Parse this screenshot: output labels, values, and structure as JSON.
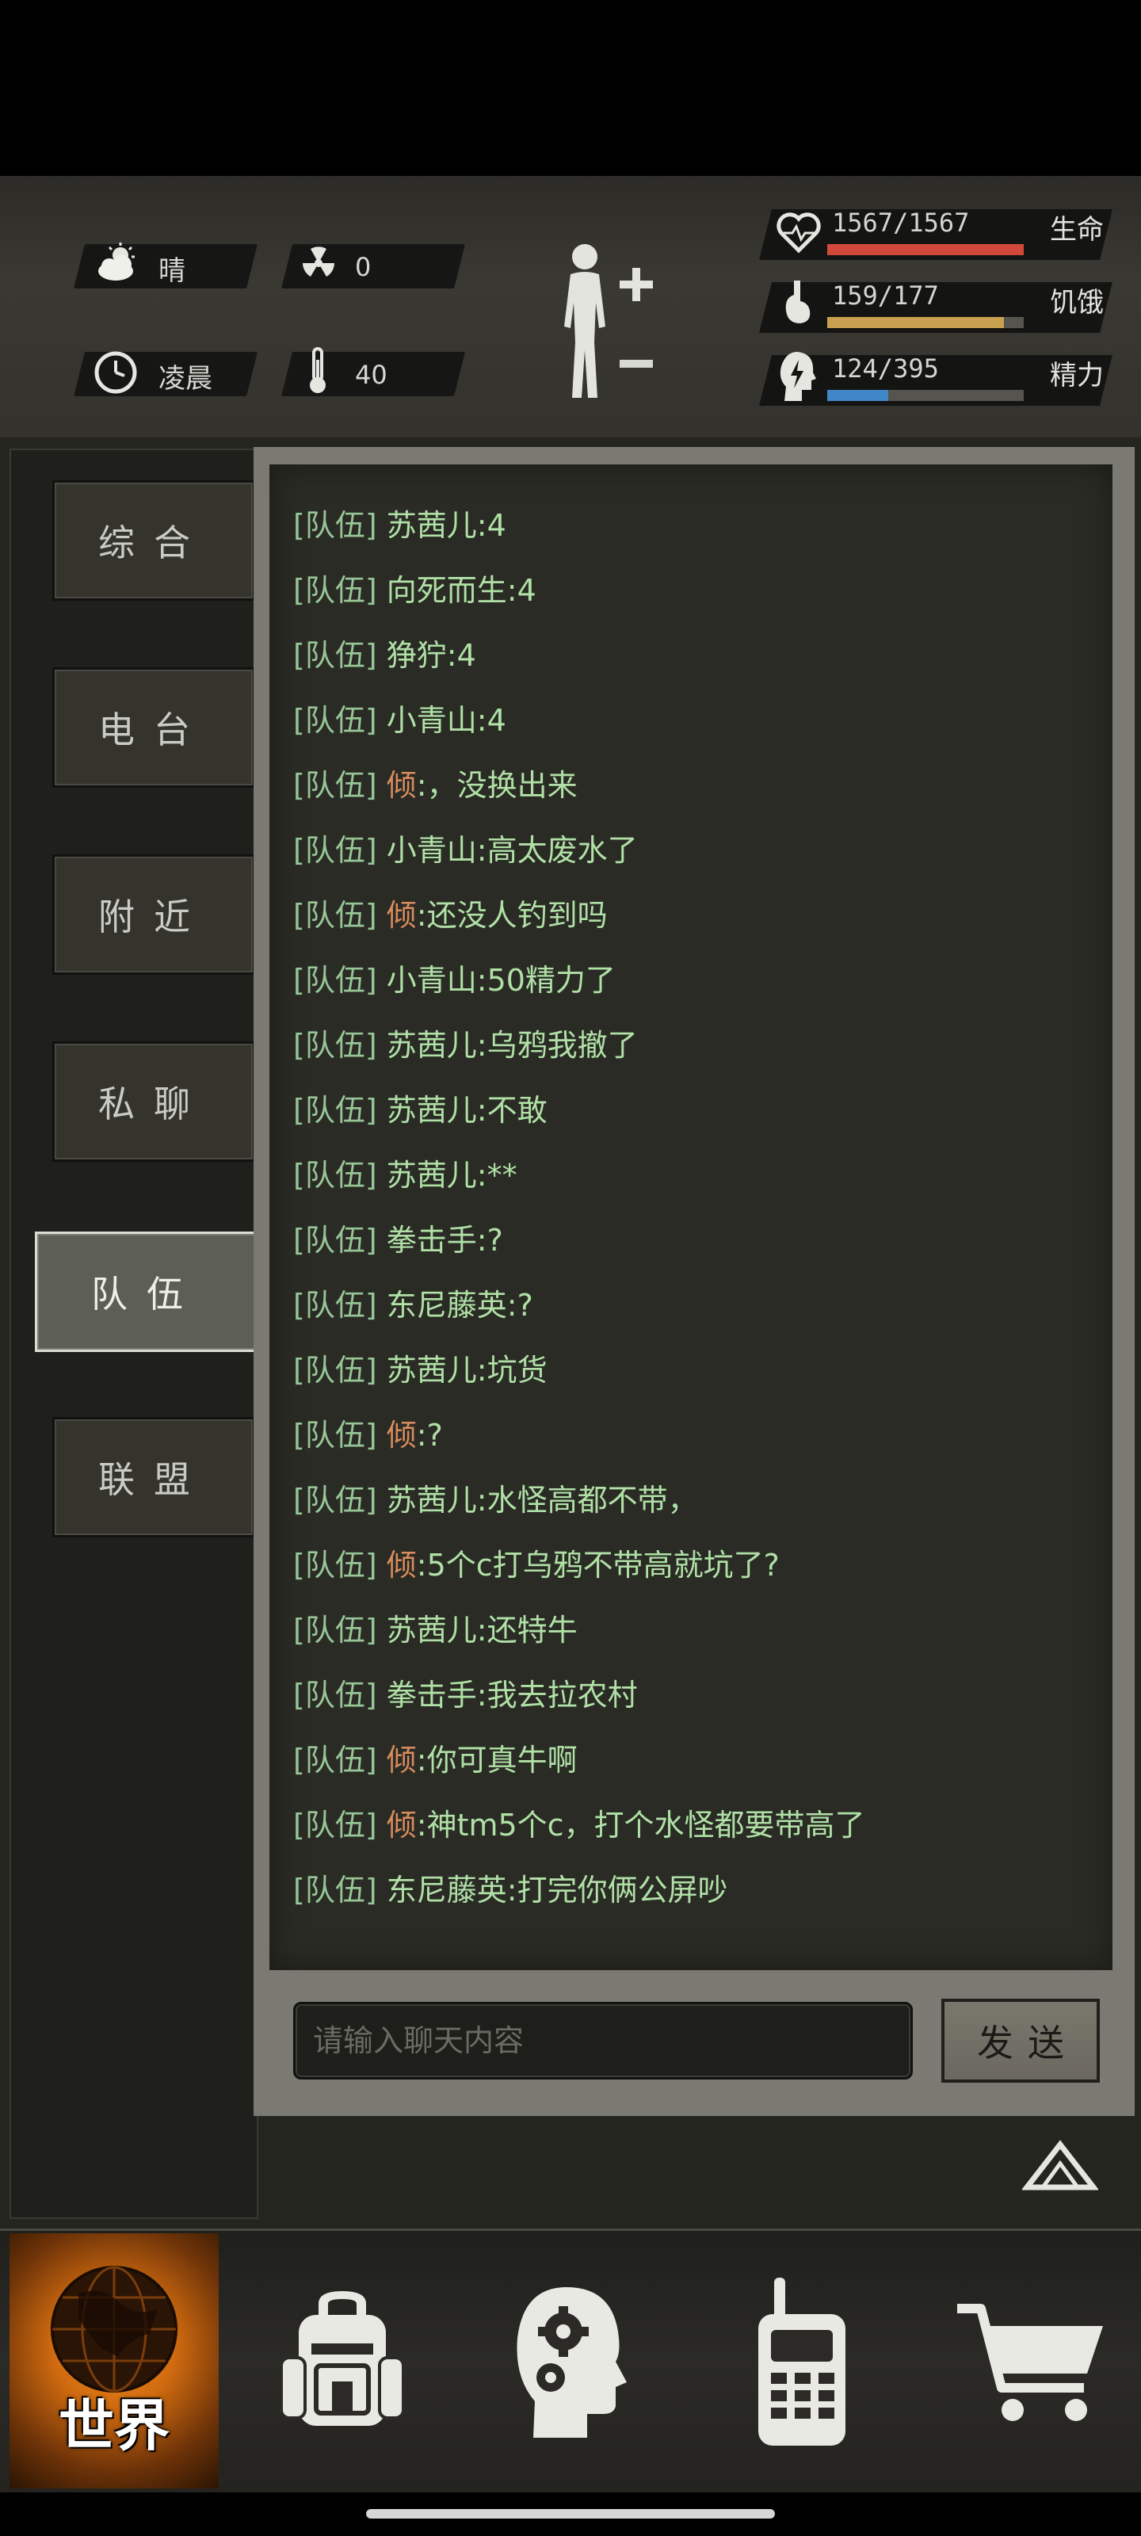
{
  "weather": {
    "label": "晴",
    "icon": "partly-cloudy-icon"
  },
  "radiation": {
    "value": "0",
    "icon": "radiation-icon"
  },
  "time_of_day": {
    "label": "凌晨",
    "icon": "clock-icon"
  },
  "temperature": {
    "value": "40",
    "icon": "thermometer-icon"
  },
  "stats": {
    "life": {
      "label": "生命",
      "value": "1567/1567",
      "fraction": 1.0,
      "color": "#d2493c",
      "icon": "heart-pulse-icon"
    },
    "hunger": {
      "label": "饥饿",
      "value": "159/177",
      "fraction": 0.9,
      "color": "#c8a050",
      "icon": "stomach-icon"
    },
    "energy": {
      "label": "精力",
      "value": "124/395",
      "fraction": 0.31,
      "color": "#3f86c8",
      "icon": "energy-head-icon"
    }
  },
  "tabs": [
    {
      "label": "综合",
      "active": false
    },
    {
      "label": "电台",
      "active": false
    },
    {
      "label": "附近",
      "active": false
    },
    {
      "label": "私聊",
      "active": false
    },
    {
      "label": "队伍",
      "active": true
    },
    {
      "label": "联盟",
      "active": false
    }
  ],
  "chat": {
    "messages": [
      {
        "tag": "[队伍]",
        "name": "苏茜儿",
        "text": ":4",
        "self": false
      },
      {
        "tag": "[队伍]",
        "name": "向死而生",
        "text": ":4",
        "self": false
      },
      {
        "tag": "[队伍]",
        "name": "狰狞",
        "text": ":4",
        "self": false
      },
      {
        "tag": "[队伍]",
        "name": "小青山",
        "text": ":4",
        "self": false
      },
      {
        "tag": "[队伍]",
        "name": "倾",
        "text": ":，没换出来",
        "self": true
      },
      {
        "tag": "[队伍]",
        "name": "小青山",
        "text": ":高太废水了",
        "self": false
      },
      {
        "tag": "[队伍]",
        "name": "倾",
        "text": ":还没人钓到吗",
        "self": true
      },
      {
        "tag": "[队伍]",
        "name": "小青山",
        "text": ":50精力了",
        "self": false
      },
      {
        "tag": "[队伍]",
        "name": "苏茜儿",
        "text": ":乌鸦我撤了",
        "self": false
      },
      {
        "tag": "[队伍]",
        "name": "苏茜儿",
        "text": ":不敢",
        "self": false
      },
      {
        "tag": "[队伍]",
        "name": "苏茜儿",
        "text": ":**",
        "self": false
      },
      {
        "tag": "[队伍]",
        "name": "拳击手",
        "text": ":?",
        "self": false
      },
      {
        "tag": "[队伍]",
        "name": "东尼藤英",
        "text": ":?",
        "self": false
      },
      {
        "tag": "[队伍]",
        "name": "苏茜儿",
        "text": ":坑货",
        "self": false
      },
      {
        "tag": "[队伍]",
        "name": "倾",
        "text": ":?",
        "self": true
      },
      {
        "tag": "[队伍]",
        "name": "苏茜儿",
        "text": ":水怪高都不带，",
        "self": false
      },
      {
        "tag": "[队伍]",
        "name": "倾",
        "text": ":5个c打乌鸦不带高就坑了?",
        "self": true
      },
      {
        "tag": "[队伍]",
        "name": "苏茜儿",
        "text": ":还特牛",
        "self": false
      },
      {
        "tag": "[队伍]",
        "name": "拳击手",
        "text": ":我去拉农村",
        "self": false
      },
      {
        "tag": "[队伍]",
        "name": "倾",
        "text": ":你可真牛啊",
        "self": true
      },
      {
        "tag": "[队伍]",
        "name": "倾",
        "text": ":神tm5个c，打个水怪都要带高了",
        "self": true
      },
      {
        "tag": "[队伍]",
        "name": "东尼藤英",
        "text": ":打完你俩公屏吵",
        "self": false
      }
    ],
    "input_placeholder": "请输入聊天内容",
    "send_label": "发送"
  },
  "bottom_nav": {
    "world_label": "世界",
    "items": [
      "globe-icon",
      "backpack-icon",
      "brain-gears-icon",
      "walkie-talkie-icon",
      "shopping-cart-icon"
    ]
  }
}
